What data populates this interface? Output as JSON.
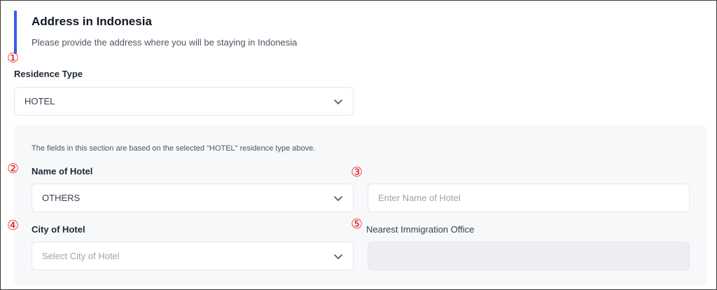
{
  "header": {
    "title": "Address in Indonesia",
    "subtitle": "Please provide the address where you will be staying in Indonesia"
  },
  "markers": [
    "①",
    "②",
    "③",
    "④",
    "⑤"
  ],
  "residence": {
    "label": "Residence Type",
    "value": "HOTEL"
  },
  "section": {
    "note": "The fields in this section are based on the selected \"HOTEL\" residence type above.",
    "hotel_name": {
      "label": "Name of Hotel",
      "value": "OTHERS"
    },
    "hotel_name_input": {
      "placeholder": "Enter Name of Hotel"
    },
    "city": {
      "label": "City of Hotel",
      "placeholder": "Select City of Hotel"
    },
    "immigration": {
      "label": "Nearest Immigration Office",
      "value": ""
    }
  },
  "colors": {
    "accent": "#3d5be8",
    "marker": "#e11d1d"
  }
}
